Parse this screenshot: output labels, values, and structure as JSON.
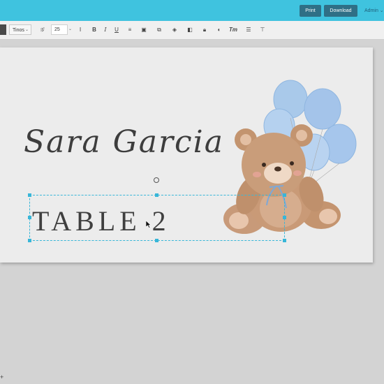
{
  "topbar": {
    "print_label": "Print",
    "download_label": "Download",
    "admin_label": "Admin"
  },
  "toolbar": {
    "font_name": "Tinos",
    "font_size": "25",
    "icons": [
      "font-style-icon",
      "line-spacing-icon",
      "bold-icon",
      "italic-icon",
      "underline-icon",
      "align-icon",
      "image-icon",
      "duplicate-icon",
      "layers-icon",
      "frame-icon",
      "lock-icon",
      "color-icon",
      "text-transform-icon",
      "list-icon",
      "align-center-icon"
    ]
  },
  "card": {
    "name_text": "Sara Garcia",
    "table_text": "TABLE 2"
  },
  "bottom": {
    "plus_label": "+"
  },
  "colors": {
    "topbar": "#3fc3df",
    "button": "#2f6f86",
    "selection": "#38b6d8",
    "canvas_bg": "#d3d3d3"
  }
}
